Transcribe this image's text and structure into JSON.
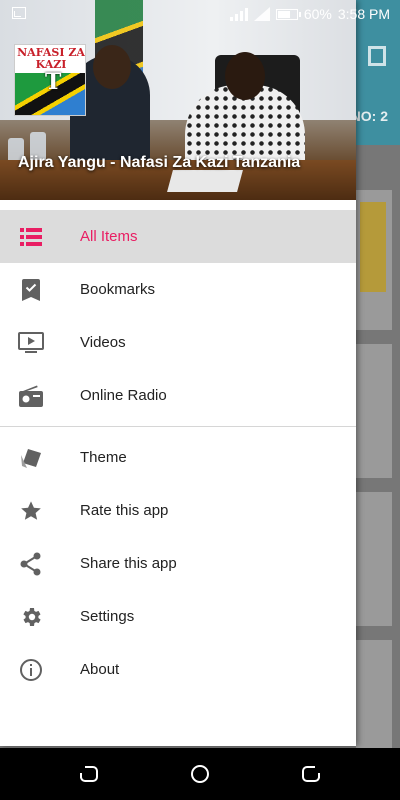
{
  "status_bar": {
    "battery": "60%",
    "time": "3:58 PM"
  },
  "background": {
    "counter_text": "NO: 2"
  },
  "drawer": {
    "header_title": "Ajira Yangu - Nafasi Za Kazi Tanzania",
    "logo_text": "NAFASI ZA KAZI",
    "logo_letter": "T",
    "accent_color": "#e91e63",
    "primary_items": [
      {
        "label": "All Items",
        "icon": "list-icon",
        "active": true
      },
      {
        "label": "Bookmarks",
        "icon": "bookmark-icon",
        "active": false
      },
      {
        "label": "Videos",
        "icon": "video-icon",
        "active": false
      },
      {
        "label": "Online Radio",
        "icon": "radio-icon",
        "active": false
      }
    ],
    "secondary_items": [
      {
        "label": "Theme",
        "icon": "theme-icon"
      },
      {
        "label": "Rate this app",
        "icon": "star-icon"
      },
      {
        "label": "Share this app",
        "icon": "share-icon"
      },
      {
        "label": "Settings",
        "icon": "gear-icon"
      },
      {
        "label": "About",
        "icon": "info-icon"
      }
    ]
  },
  "nav_bar": {
    "buttons": [
      "back-icon",
      "home-icon",
      "recents-icon"
    ]
  }
}
